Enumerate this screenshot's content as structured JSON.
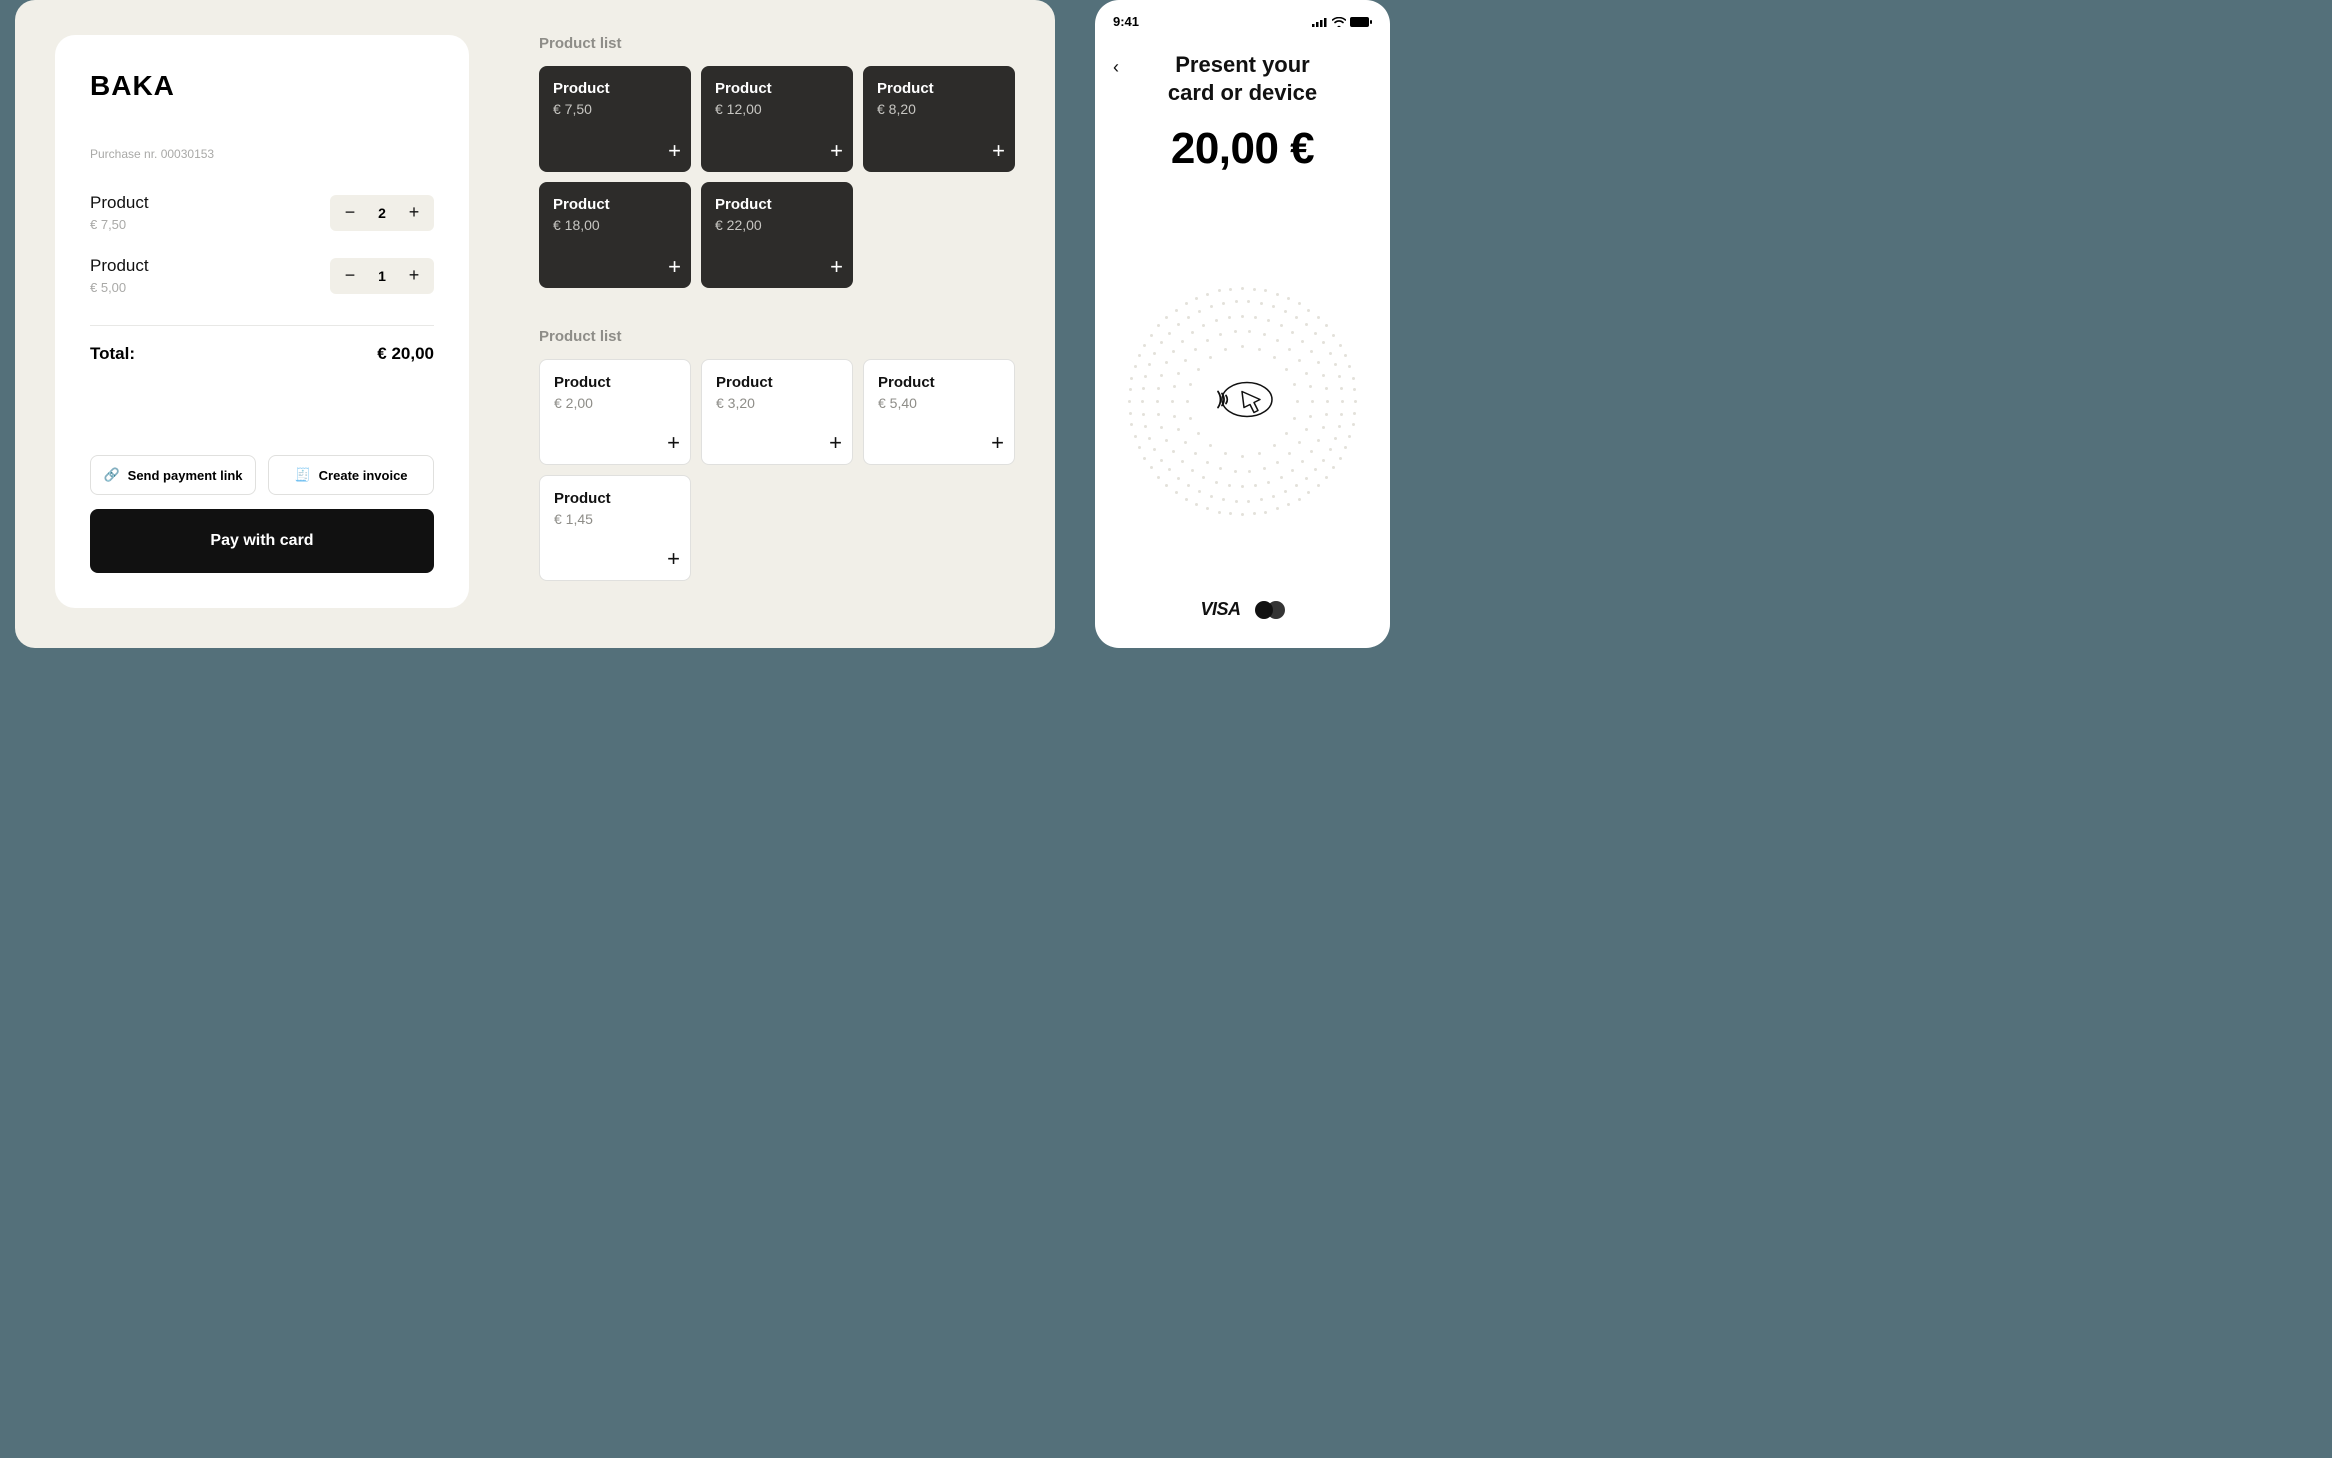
{
  "receipt": {
    "brand": "BAKA",
    "purchaseLabel": "Purchase  nr.  00030153",
    "items": [
      {
        "name": "Product",
        "price": "€ 7,50",
        "qty": "2"
      },
      {
        "name": "Product",
        "price": "€ 5,00",
        "qty": "1"
      }
    ],
    "totalLabel": "Total:",
    "totalValue": "€ 20,00",
    "sendLink": "Send payment link",
    "createInvoice": "Create invoice",
    "pay": "Pay with card"
  },
  "grids": [
    {
      "title": "Product list",
      "style": "dark",
      "products": [
        {
          "name": "Product",
          "price": "€ 7,50"
        },
        {
          "name": "Product",
          "price": "€ 12,00"
        },
        {
          "name": "Product",
          "price": "€ 8,20"
        },
        {
          "name": "Product",
          "price": "€ 18,00"
        },
        {
          "name": "Product",
          "price": "€ 22,00"
        }
      ]
    },
    {
      "title": "Product list",
      "style": "light",
      "products": [
        {
          "name": "Product",
          "price": "€ 2,00"
        },
        {
          "name": "Product",
          "price": "€ 3,20"
        },
        {
          "name": "Product",
          "price": "€ 5,40"
        },
        {
          "name": "Product",
          "price": "€ 1,45"
        }
      ]
    }
  ],
  "phone": {
    "time": "9:41",
    "title": "Present your\ncard or device",
    "amount": "20,00 €",
    "visa": "VISA"
  }
}
